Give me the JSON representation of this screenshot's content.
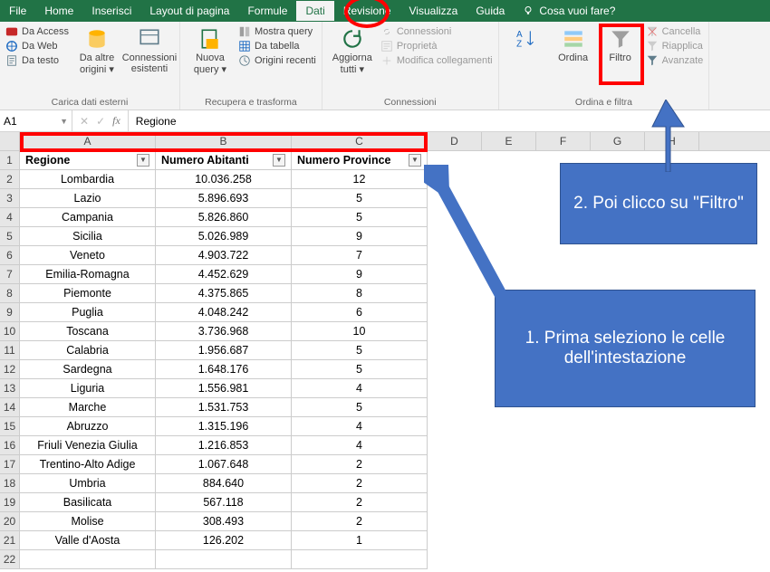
{
  "menu": {
    "tabs": [
      "File",
      "Home",
      "Inserisci",
      "Layout di pagina",
      "Formule",
      "Dati",
      "Revisione",
      "Visualizza",
      "Guida"
    ],
    "active_index": 5,
    "tellme": "Cosa vuoi fare?"
  },
  "ribbon": {
    "g1": {
      "access": "Da Access",
      "web": "Da Web",
      "testo": "Da testo",
      "altre": "Da altre origini ▾",
      "conn": "Connessioni esistenti",
      "label": "Carica dati esterni"
    },
    "g2": {
      "nuova": "Nuova query ▾",
      "mostra": "Mostra query",
      "tabella": "Da tabella",
      "recenti": "Origini recenti",
      "label": "Recupera e trasforma"
    },
    "g3": {
      "aggiorna": "Aggiorna tutti ▾",
      "conn": "Connessioni",
      "prop": "Proprietà",
      "mod": "Modifica collegamenti",
      "label": "Connessioni"
    },
    "g4": {
      "sort": "",
      "ordina": "Ordina",
      "filtro": "Filtro",
      "cancella": "Cancella",
      "riapplica": "Riapplica",
      "avanzate": "Avanzate",
      "label": "Ordina e filtra"
    }
  },
  "fx": {
    "name": "A1",
    "formula": "Regione"
  },
  "cols": [
    "A",
    "B",
    "C",
    "D",
    "E",
    "F",
    "G",
    "H"
  ],
  "headers": {
    "a": "Regione",
    "b": "Numero Abitanti",
    "c": "Numero Province"
  },
  "rows": [
    {
      "n": 1
    },
    {
      "n": 2,
      "a": "Lombardia",
      "b": "10.036.258",
      "c": "12"
    },
    {
      "n": 3,
      "a": "Lazio",
      "b": "5.896.693",
      "c": "5"
    },
    {
      "n": 4,
      "a": "Campania",
      "b": "5.826.860",
      "c": "5"
    },
    {
      "n": 5,
      "a": "Sicilia",
      "b": "5.026.989",
      "c": "9"
    },
    {
      "n": 6,
      "a": "Veneto",
      "b": "4.903.722",
      "c": "7"
    },
    {
      "n": 7,
      "a": "Emilia-Romagna",
      "b": "4.452.629",
      "c": "9"
    },
    {
      "n": 8,
      "a": "Piemonte",
      "b": "4.375.865",
      "c": "8"
    },
    {
      "n": 9,
      "a": "Puglia",
      "b": "4.048.242",
      "c": "6"
    },
    {
      "n": 10,
      "a": "Toscana",
      "b": "3.736.968",
      "c": "10"
    },
    {
      "n": 11,
      "a": "Calabria",
      "b": "1.956.687",
      "c": "5"
    },
    {
      "n": 12,
      "a": "Sardegna",
      "b": "1.648.176",
      "c": "5"
    },
    {
      "n": 13,
      "a": "Liguria",
      "b": "1.556.981",
      "c": "4"
    },
    {
      "n": 14,
      "a": "Marche",
      "b": "1.531.753",
      "c": "5"
    },
    {
      "n": 15,
      "a": "Abruzzo",
      "b": "1.315.196",
      "c": "4"
    },
    {
      "n": 16,
      "a": "Friuli Venezia Giulia",
      "b": "1.216.853",
      "c": "4"
    },
    {
      "n": 17,
      "a": "Trentino-Alto Adige",
      "b": "1.067.648",
      "c": "2"
    },
    {
      "n": 18,
      "a": "Umbria",
      "b": "884.640",
      "c": "2"
    },
    {
      "n": 19,
      "a": "Basilicata",
      "b": "567.118",
      "c": "2"
    },
    {
      "n": 20,
      "a": "Molise",
      "b": "308.493",
      "c": "2"
    },
    {
      "n": 21,
      "a": "Valle d'Aosta",
      "b": "126.202",
      "c": "1"
    },
    {
      "n": 22
    }
  ],
  "callouts": {
    "c1": "1. Prima seleziono le celle dell'intestazione",
    "c2": "2. Poi clicco su \"Filtro\""
  }
}
